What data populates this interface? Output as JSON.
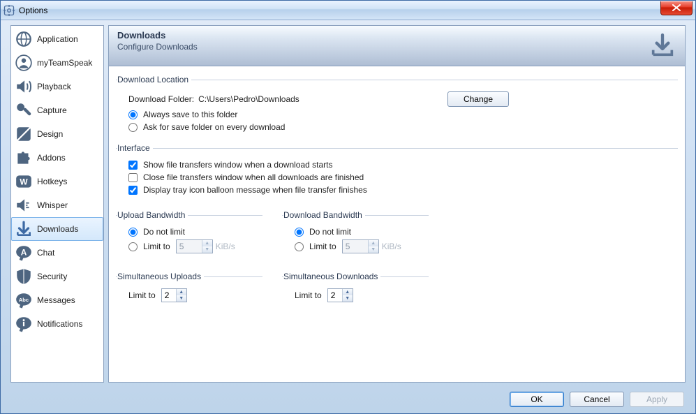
{
  "window": {
    "title": "Options"
  },
  "sidebar": {
    "items": [
      {
        "id": "application",
        "label": "Application"
      },
      {
        "id": "myteamspeak",
        "label": "myTeamSpeak"
      },
      {
        "id": "playback",
        "label": "Playback"
      },
      {
        "id": "capture",
        "label": "Capture"
      },
      {
        "id": "design",
        "label": "Design"
      },
      {
        "id": "addons",
        "label": "Addons"
      },
      {
        "id": "hotkeys",
        "label": "Hotkeys"
      },
      {
        "id": "whisper",
        "label": "Whisper"
      },
      {
        "id": "downloads",
        "label": "Downloads"
      },
      {
        "id": "chat",
        "label": "Chat"
      },
      {
        "id": "security",
        "label": "Security"
      },
      {
        "id": "messages",
        "label": "Messages"
      },
      {
        "id": "notifications",
        "label": "Notifications"
      }
    ],
    "selected": "downloads"
  },
  "header": {
    "title": "Downloads",
    "subtitle": "Configure Downloads"
  },
  "downloadLocation": {
    "legend": "Download Location",
    "folderLabel": "Download Folder:",
    "folderPath": "C:\\Users\\Pedro\\Downloads",
    "changeLabel": "Change",
    "optAlways": "Always save to this folder",
    "optAsk": "Ask for save folder on every download",
    "selected": "always"
  },
  "interface": {
    "legend": "Interface",
    "showTransfers": {
      "label": "Show file transfers window when a download starts",
      "checked": true
    },
    "closeWhenFinished": {
      "label": "Close file transfers window when all downloads are finished",
      "checked": false
    },
    "trayBalloon": {
      "label": "Display tray icon balloon message when file transfer finishes",
      "checked": true
    }
  },
  "uploadBandwidth": {
    "legend": "Upload Bandwidth",
    "noLimit": "Do not limit",
    "limitTo": "Limit to",
    "value": "5",
    "unit": "KiB/s",
    "selected": "nolimit"
  },
  "downloadBandwidth": {
    "legend": "Download Bandwidth",
    "noLimit": "Do not limit",
    "limitTo": "Limit to",
    "value": "5",
    "unit": "KiB/s",
    "selected": "nolimit"
  },
  "simUploads": {
    "legend": "Simultaneous Uploads",
    "limitTo": "Limit to",
    "value": "2"
  },
  "simDownloads": {
    "legend": "Simultaneous Downloads",
    "limitTo": "Limit to",
    "value": "2"
  },
  "footer": {
    "ok": "OK",
    "cancel": "Cancel",
    "apply": "Apply"
  }
}
